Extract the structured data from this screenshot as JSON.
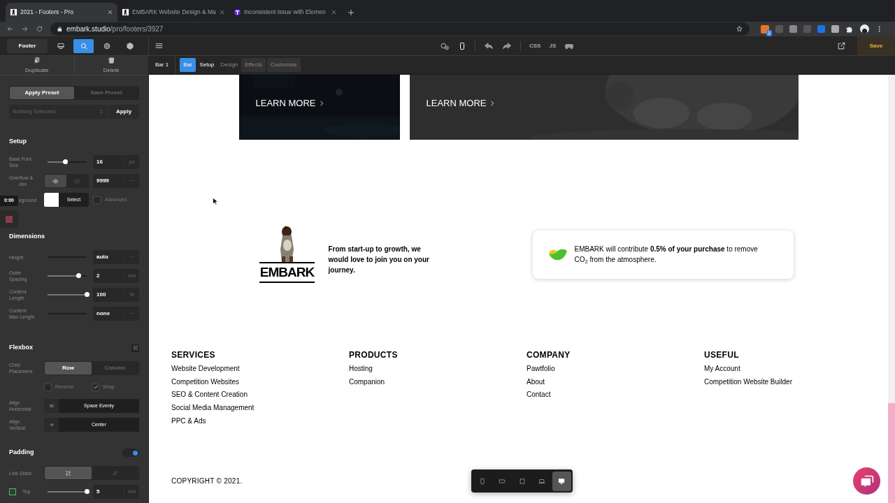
{
  "browser": {
    "tabs": [
      {
        "title": "2021 - Footers - Pro",
        "selected": true,
        "kind": "figure"
      },
      {
        "title": "EMBARK Website Design & Ma",
        "selected": false,
        "kind": "figure"
      },
      {
        "title": "Inconsistent Issue with Elemen",
        "selected": false,
        "kind": "letter"
      }
    ],
    "url": {
      "host": "embark.studio",
      "path": "/pro/footers/3927"
    },
    "extension_badge": "3"
  },
  "editor": {
    "panel_title": "Footer",
    "panel_tabs": [
      {
        "kind": "monitor",
        "selected": false
      },
      {
        "kind": "search",
        "selected": true
      },
      {
        "kind": "gear",
        "selected": false
      },
      {
        "kind": "hexagon",
        "selected": false
      }
    ],
    "code_buttons": [
      "CSS",
      "JS"
    ],
    "save": "Save",
    "breadcrumb": {
      "element": "Bar 1",
      "chip": "Bar",
      "tabs": [
        {
          "label": "Setup",
          "selected": true,
          "kind": "plain"
        },
        {
          "label": "Design",
          "selected": false,
          "kind": "plain"
        },
        {
          "label": "Effects",
          "selected": false,
          "kind": "boxed"
        },
        {
          "label": "Customize",
          "selected": false,
          "kind": "boxed"
        }
      ]
    }
  },
  "panel": {
    "actions": [
      {
        "label": "Duplicate",
        "kind": "copy"
      },
      {
        "label": "Delete",
        "kind": "trash"
      }
    ],
    "preset_tabs": [
      {
        "label": "Apply Preset",
        "selected": true
      },
      {
        "label": "Save Preset",
        "selected": false
      }
    ],
    "preset_select": {
      "placeholder": "Nothing Selected"
    },
    "preset_apply": "Apply",
    "sections": [
      {
        "title": "Setup",
        "rows": [
          {
            "kind": "slider",
            "label": [
              "Base Font",
              "Size"
            ],
            "level": 0.45,
            "value": "16",
            "suffix": "px"
          },
          {
            "kind": "toggle_value",
            "label": [
              "Overflow &",
              "dex"
            ],
            "options": [
              {
                "kind": "eye",
                "selected": true
              },
              {
                "kind": "eye-off",
                "selected": false
              }
            ],
            "value": "9999",
            "suffix": "···"
          },
          {
            "kind": "color",
            "label": [
              "kground"
            ],
            "button": "Select",
            "checkbox": {
              "label": "Advanced",
              "checked": false
            }
          }
        ]
      },
      {
        "title": "Dimensions",
        "rows": [
          {
            "kind": "slider",
            "label": [
              "Height"
            ],
            "value": "auto",
            "suffix": "···"
          },
          {
            "kind": "slider",
            "label": [
              "Outer",
              "Spacing"
            ],
            "level": 0.8,
            "value": "2",
            "suffix": "em"
          },
          {
            "kind": "slider",
            "label": [
              "Content",
              "Length"
            ],
            "level": 1,
            "value": "100",
            "suffix": "%"
          },
          {
            "kind": "slider",
            "label": [
              "Content",
              "Max Length"
            ],
            "value": "none",
            "suffix": "···"
          }
        ]
      },
      {
        "title": "Flexbox",
        "focus_button": true,
        "rows": [
          {
            "kind": "segmented",
            "label": [
              "Child",
              "Placement"
            ],
            "options": [
              {
                "label": "Row",
                "selected": true
              },
              {
                "label": "Column",
                "selected": false
              }
            ]
          },
          {
            "kind": "checks",
            "items": [
              {
                "label": "Reverse",
                "checked": false
              },
              {
                "label": "Wrap",
                "checked": true
              }
            ]
          },
          {
            "kind": "align",
            "label": [
              "Align",
              "Horizontal"
            ],
            "value": "Space Evenly"
          },
          {
            "kind": "align",
            "label": [
              "Align",
              "Vertical"
            ],
            "value": "Center"
          }
        ]
      },
      {
        "title": "Padding",
        "toggle": {
          "on": true
        },
        "rows": [
          {
            "kind": "icon_segmented",
            "label": [
              "Link Sides"
            ],
            "options": [
              {
                "kind": "unlink",
                "selected": true
              },
              {
                "kind": "link",
                "selected": false
              }
            ]
          },
          {
            "kind": "slider",
            "label": [
              "Top"
            ],
            "marker": true,
            "level": 1,
            "value": "5",
            "suffix": "em"
          }
        ]
      }
    ]
  },
  "video_overlay": {
    "time": "0:00"
  },
  "canvas": {
    "promo_cards": [
      {
        "cta": "LEARN MORE",
        "kind": "dark"
      },
      {
        "cta": "LEARN MORE",
        "kind": "dog"
      }
    ],
    "brand": {
      "wordmark": "EMBARK",
      "tagline": "From start-up to growth, we would love to join you on your journey."
    },
    "climate_card": {
      "text": "EMBARK will contribute **0.5% of your purchase** to remove CO$_{2}$ from the atmosphere."
    },
    "footer_columns": [
      {
        "heading": "SERVICES",
        "links": [
          "Website Development",
          "Competition Websites",
          "SEO & Content Creation",
          "Social Media Management",
          "PPC & Ads"
        ]
      },
      {
        "heading": "PRODUCTS",
        "links": [
          "Hosting",
          "Companion"
        ]
      },
      {
        "heading": "COMPANY",
        "links": [
          "Pawtfolio",
          "About",
          "Contact"
        ]
      },
      {
        "heading": "USEFUL",
        "links": [
          "My Account",
          "Competition Website Builder"
        ]
      }
    ],
    "copyright": "COPYRIGHT © 2021.",
    "device_switcher": [
      {
        "kind": "phone",
        "selected": false
      },
      {
        "kind": "phone-landscape",
        "selected": false
      },
      {
        "kind": "tablet",
        "selected": false
      },
      {
        "kind": "laptop",
        "selected": false
      },
      {
        "kind": "desktop",
        "selected": true
      }
    ]
  }
}
